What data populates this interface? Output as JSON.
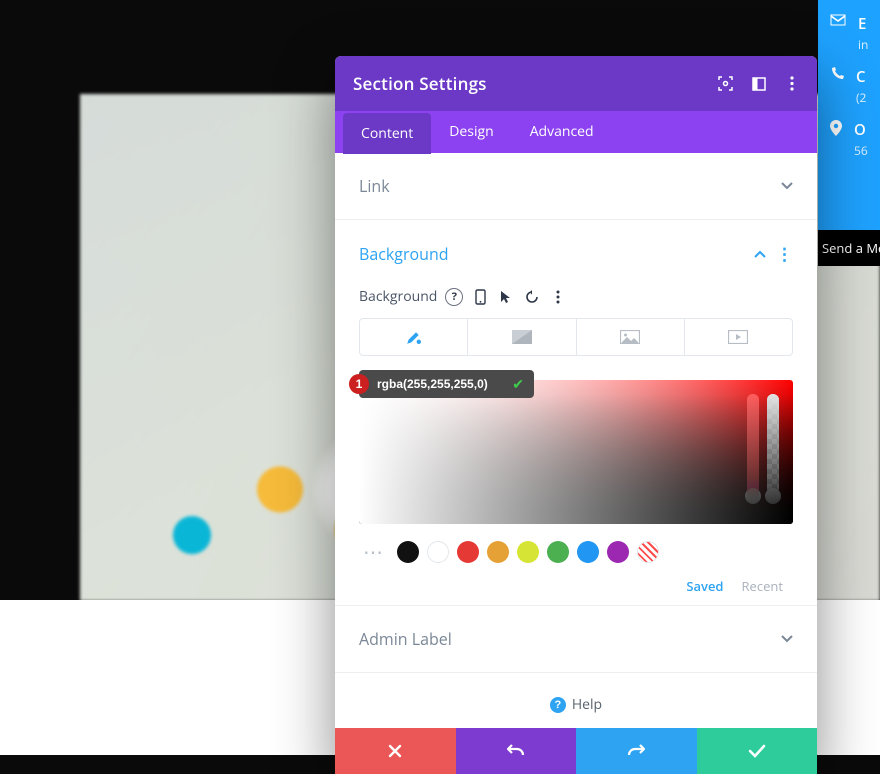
{
  "modal": {
    "title": "Section Settings",
    "tabs": [
      "Content",
      "Design",
      "Advanced"
    ],
    "active_tab": 0
  },
  "accordion": {
    "link": {
      "title": "Link"
    },
    "background": {
      "title": "Background",
      "field_label": "Background",
      "color_value": "rgba(255,255,255,0)",
      "badge": "1",
      "saved_label": "Saved",
      "recent_label": "Recent",
      "swatches": [
        "#111111",
        "#ffffff",
        "#e53935",
        "#e5a135",
        "#d6e535",
        "#4caf50",
        "#2196f3",
        "#9c27b0"
      ]
    },
    "admin": {
      "title": "Admin Label"
    }
  },
  "help": {
    "label": "Help"
  },
  "contact": {
    "email": {
      "label": "E",
      "sub": "in"
    },
    "call": {
      "label": "C",
      "sub": "(2"
    },
    "office": {
      "label": "O",
      "sub": "56"
    },
    "send": "Send a Me"
  }
}
